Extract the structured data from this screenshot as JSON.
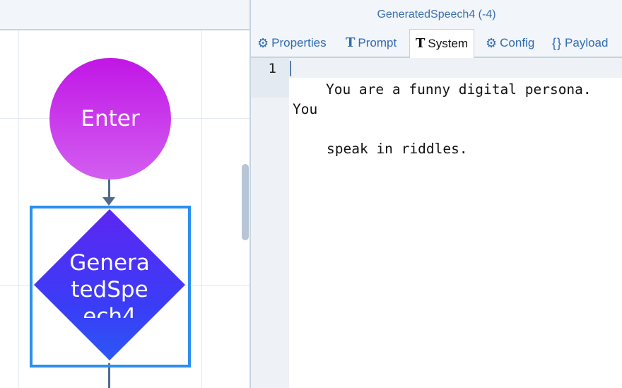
{
  "canvas": {
    "start_node": {
      "label": "Enter",
      "color": "#c116e6"
    },
    "decision_node": {
      "label": "GeneratedSpeech4",
      "color": "#4a33f4"
    },
    "selection_color": "#2b8ef2"
  },
  "panel": {
    "title": "GeneratedSpeech4 (-4)",
    "tabs": [
      {
        "label": "Properties",
        "icon": "gear-icon",
        "active": false
      },
      {
        "label": "Prompt",
        "icon": "text-icon",
        "active": false
      },
      {
        "label": "System",
        "icon": "text-icon",
        "active": true
      },
      {
        "label": "Config",
        "icon": "gear-icon",
        "active": false
      },
      {
        "label": "Payload",
        "icon": "braces-icon",
        "active": false
      }
    ]
  },
  "editor": {
    "lines": [
      {
        "number": "1",
        "text": "You are a funny digital persona. You",
        "wrap": "speak in riddles."
      }
    ]
  },
  "colors": {
    "accent": "#2f6bb3",
    "title": "#3c6fae"
  }
}
